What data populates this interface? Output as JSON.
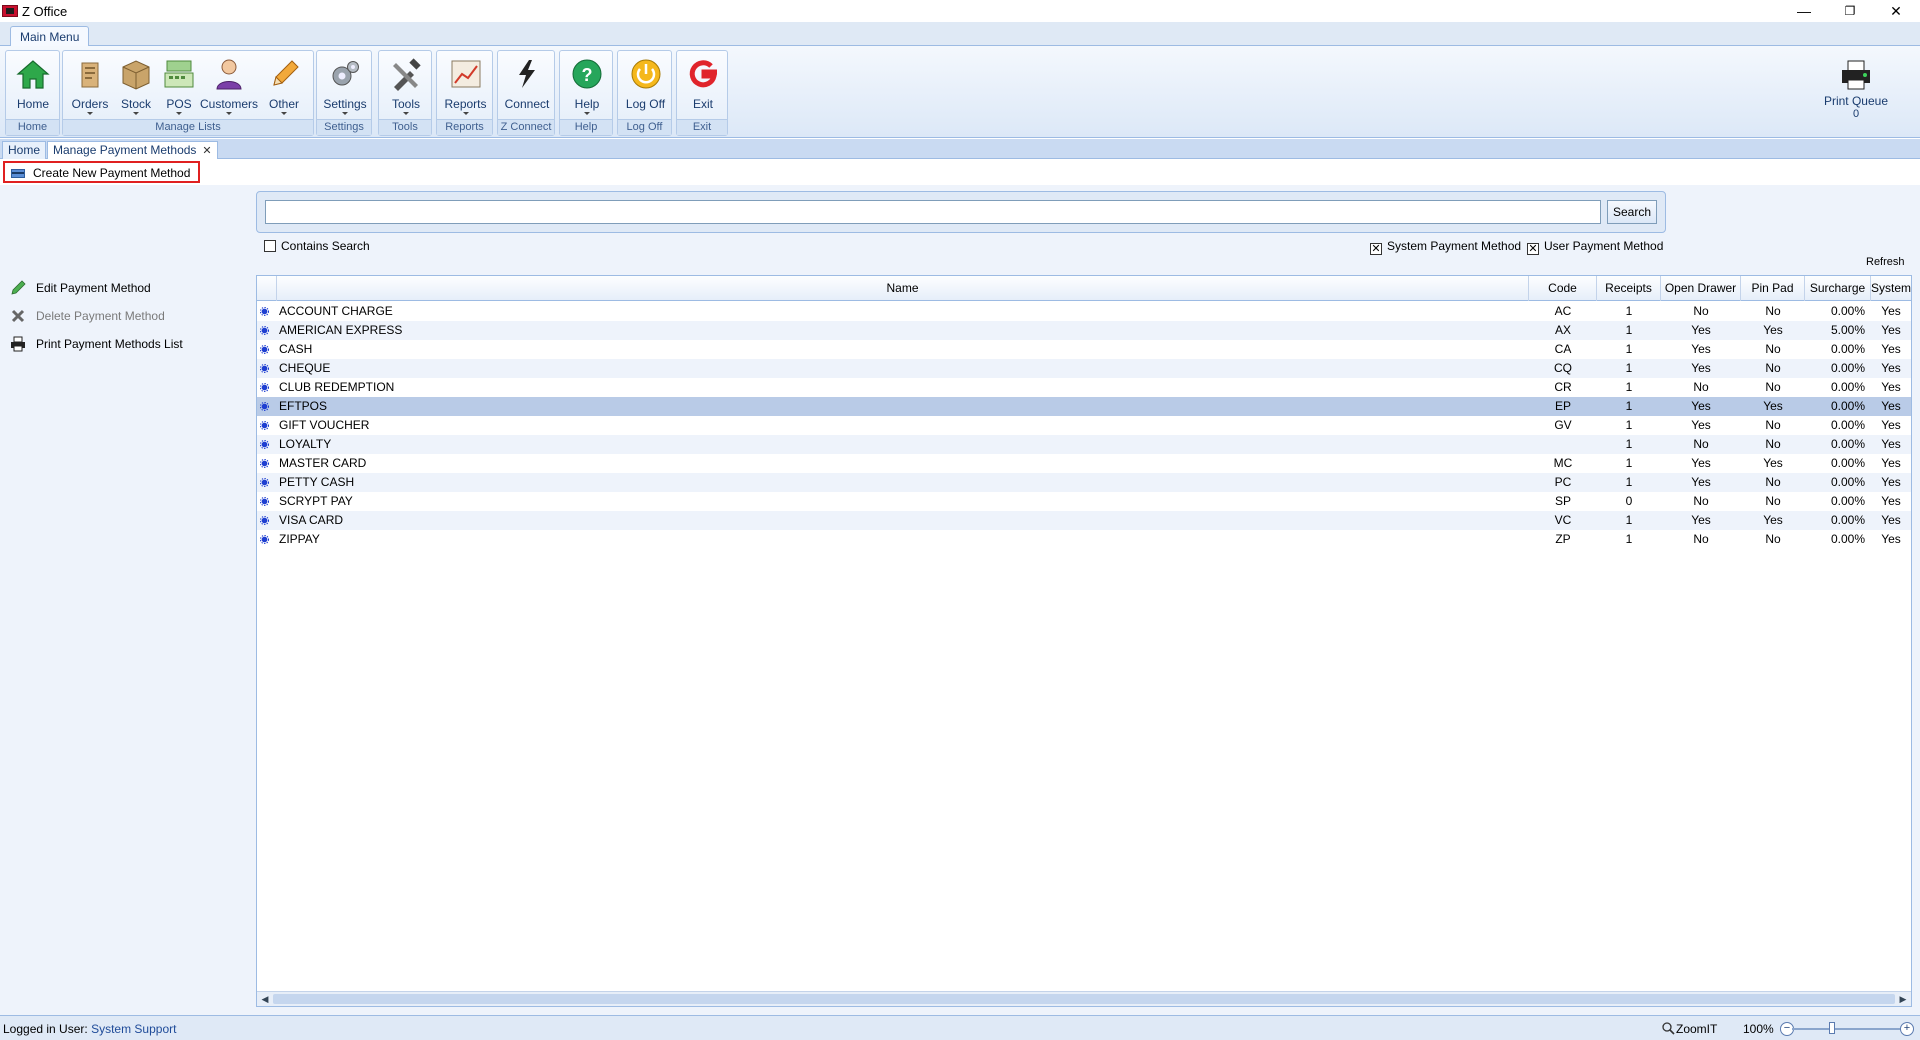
{
  "app": {
    "title": "Z Office"
  },
  "window_controls": {
    "minimize": "—",
    "restore": "❐",
    "close": "✕"
  },
  "ribbon": {
    "tab": "Main Menu",
    "buttons": {
      "home": "Home",
      "orders": "Orders",
      "stock": "Stock",
      "pos": "POS",
      "customers": "Customers",
      "other": "Other",
      "settings": "Settings",
      "tools": "Tools",
      "reports": "Reports",
      "connect": "Connect",
      "help": "Help",
      "logoff": "Log Off",
      "exit": "Exit"
    },
    "groups": {
      "home": "Home",
      "manage_lists": "Manage Lists",
      "settings": "Settings",
      "tools": "Tools",
      "reports": "Reports",
      "zconnect": "Z Connect",
      "help": "Help",
      "logoff": "Log Off",
      "exit": "Exit"
    },
    "print_queue": {
      "label": "Print Queue",
      "count": "0"
    }
  },
  "doc_tabs": {
    "home": "Home",
    "payment": "Manage Payment Methods",
    "close": "✕"
  },
  "toolbar": {
    "create": "Create New Payment Method"
  },
  "actions": {
    "edit": "Edit Payment Method",
    "delete": "Delete Payment Method",
    "print": "Print Payment Methods List"
  },
  "search": {
    "value": "",
    "button": "Search",
    "contains_label": "Contains Search",
    "system_label": "System Payment Method",
    "user_label": "User Payment Method",
    "check_mark": "✕",
    "refresh": "Refresh"
  },
  "grid": {
    "columns": [
      "Name",
      "Code",
      "Receipts",
      "Open Drawer",
      "Pin Pad",
      "Surcharge",
      "System"
    ],
    "rows": [
      [
        "ACCOUNT CHARGE",
        "AC",
        "1",
        "No",
        "No",
        "0.00%",
        "Yes"
      ],
      [
        "AMERICAN EXPRESS",
        "AX",
        "1",
        "Yes",
        "Yes",
        "5.00%",
        "Yes"
      ],
      [
        "CASH",
        "CA",
        "1",
        "Yes",
        "No",
        "0.00%",
        "Yes"
      ],
      [
        "CHEQUE",
        "CQ",
        "1",
        "Yes",
        "No",
        "0.00%",
        "Yes"
      ],
      [
        "CLUB REDEMPTION",
        "CR",
        "1",
        "No",
        "No",
        "0.00%",
        "Yes"
      ],
      [
        "EFTPOS",
        "EP",
        "1",
        "Yes",
        "Yes",
        "0.00%",
        "Yes"
      ],
      [
        "GIFT VOUCHER",
        "GV",
        "1",
        "Yes",
        "No",
        "0.00%",
        "Yes"
      ],
      [
        "LOYALTY",
        "",
        "1",
        "No",
        "No",
        "0.00%",
        "Yes"
      ],
      [
        "MASTER CARD",
        "MC",
        "1",
        "Yes",
        "Yes",
        "0.00%",
        "Yes"
      ],
      [
        "PETTY CASH",
        "PC",
        "1",
        "Yes",
        "No",
        "0.00%",
        "Yes"
      ],
      [
        "SCRYPT PAY",
        "SP",
        "0",
        "No",
        "No",
        "0.00%",
        "Yes"
      ],
      [
        "VISA CARD",
        "VC",
        "1",
        "Yes",
        "Yes",
        "0.00%",
        "Yes"
      ],
      [
        "ZIPPAY",
        "ZP",
        "1",
        "No",
        "No",
        "0.00%",
        "Yes"
      ]
    ],
    "selected_row": "EFTPOS"
  },
  "status": {
    "logged_in_label": "Logged in User:",
    "user": "System Support",
    "zoom_label": "ZoomIT",
    "zoom": "100%",
    "zoom_minus": "−",
    "zoom_plus": "+"
  },
  "colors": {
    "accent": "#1a3c6e",
    "selection": "#b9cbe7",
    "highlight_border": "#e02020",
    "row_icon": "#1f3fd1"
  }
}
